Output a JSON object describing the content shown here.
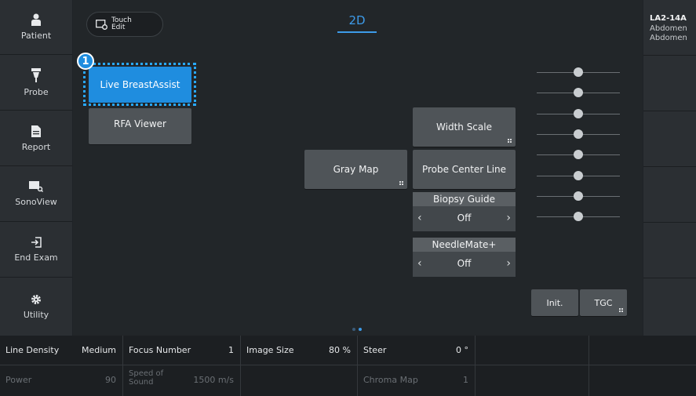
{
  "sidebar": {
    "items": [
      {
        "label": "Patient",
        "icon": "person-icon"
      },
      {
        "label": "Probe",
        "icon": "probe-icon"
      },
      {
        "label": "Report",
        "icon": "document-icon"
      },
      {
        "label": "SonoView",
        "icon": "sonoview-icon"
      },
      {
        "label": "End Exam",
        "icon": "exit-icon"
      },
      {
        "label": "Utility",
        "icon": "gear-icon"
      }
    ]
  },
  "header": {
    "touch_edit_line1": "Touch",
    "touch_edit_line2": "Edit",
    "mode_title": "2D"
  },
  "buttons": {
    "live_breast_assist": "Live BreastAssist",
    "rfa_viewer": "RFA Viewer",
    "gray_map": "Gray Map",
    "width_scale": "Width Scale",
    "probe_center_line": "Probe Center Line",
    "init": "Init.",
    "tgc": "TGC"
  },
  "callout_number": "1",
  "biopsy_guide": {
    "title": "Biopsy Guide",
    "value": "Off",
    "prev": "‹",
    "next": "›"
  },
  "needlemate": {
    "title": "NeedleMate+",
    "value": "Off",
    "prev": "‹",
    "next": "›"
  },
  "tgc_levels": [
    0.5,
    0.5,
    0.5,
    0.5,
    0.5,
    0.5,
    0.5,
    0.5
  ],
  "page_indicator": {
    "pages": 2,
    "current": 2
  },
  "right_panel": {
    "probe_name": "LA2-14A",
    "presets": [
      "Abdomen",
      "Abdomen"
    ]
  },
  "params": {
    "row1": [
      {
        "label": "Line Density",
        "value": "Medium"
      },
      {
        "label": "Focus Number",
        "value": "1"
      },
      {
        "label": "Image Size",
        "value": "80 %"
      },
      {
        "label": "Steer",
        "value": "0 °"
      }
    ],
    "row2": [
      {
        "label": "Power",
        "value": "90"
      },
      {
        "label": "Speed of Sound",
        "value": "1500 m/s"
      },
      {
        "label": "",
        "value": ""
      },
      {
        "label": "Chroma Map",
        "value": "1"
      }
    ]
  },
  "colors": {
    "accent": "#3d9be9",
    "selected_button": "#1f8ddf",
    "focus_ring": "#29a8ff",
    "button": "#4f5458"
  }
}
